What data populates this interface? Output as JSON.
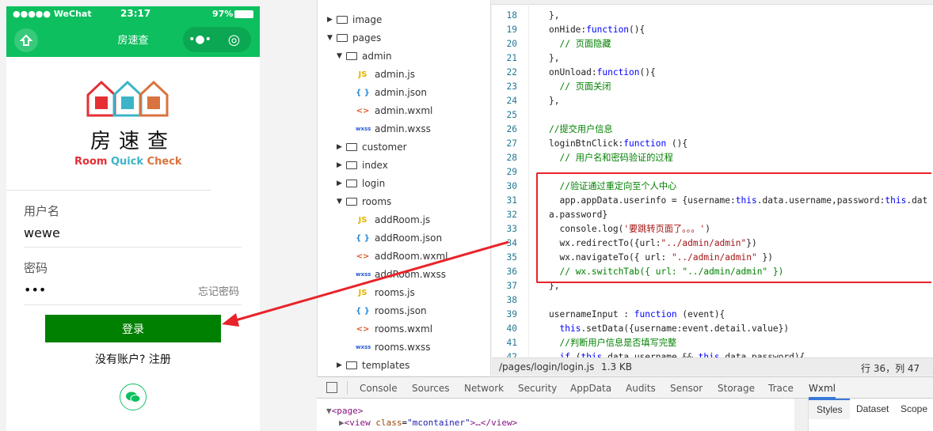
{
  "phone": {
    "status": {
      "carrier": "●●●●● WeChat",
      "time": "23:17",
      "battery": "97%"
    },
    "nav": {
      "title": "房速查",
      "more_icon": "•●•",
      "record_icon": "◎"
    },
    "logo": {
      "title": "房速查",
      "subtitle_words": [
        "Room",
        "Quick",
        "Check"
      ],
      "colors": [
        "#e52f35",
        "#3bb4c8",
        "#d9733f"
      ]
    },
    "form": {
      "username_label": "用户名",
      "username_value": "wewe",
      "password_label": "密码",
      "password_value": "•••",
      "forgot": "忘记密码",
      "login_button": "登录",
      "register": "没有账户? 注册"
    },
    "accent": "#0dbf5e"
  },
  "tree": [
    {
      "name": "image",
      "type": "folder",
      "level": 0,
      "open": false
    },
    {
      "name": "pages",
      "type": "folder",
      "level": 0,
      "open": true
    },
    {
      "name": "admin",
      "type": "folder",
      "level": 1,
      "open": true
    },
    {
      "name": "admin.js",
      "type": "js",
      "level": 2
    },
    {
      "name": "admin.json",
      "type": "json",
      "level": 2
    },
    {
      "name": "admin.wxml",
      "type": "wxml",
      "level": 2
    },
    {
      "name": "admin.wxss",
      "type": "wxss",
      "level": 2
    },
    {
      "name": "customer",
      "type": "folder",
      "level": 1,
      "open": false
    },
    {
      "name": "index",
      "type": "folder",
      "level": 1,
      "open": false
    },
    {
      "name": "login",
      "type": "folder",
      "level": 1,
      "open": false
    },
    {
      "name": "rooms",
      "type": "folder",
      "level": 1,
      "open": true
    },
    {
      "name": "addRoom.js",
      "type": "js",
      "level": 2
    },
    {
      "name": "addRoom.json",
      "type": "json",
      "level": 2
    },
    {
      "name": "addRoom.wxml",
      "type": "wxml",
      "level": 2
    },
    {
      "name": "addRoom.wxss",
      "type": "wxss",
      "level": 2
    },
    {
      "name": "rooms.js",
      "type": "js",
      "level": 2
    },
    {
      "name": "rooms.json",
      "type": "json",
      "level": 2
    },
    {
      "name": "rooms.wxml",
      "type": "wxml",
      "level": 2
    },
    {
      "name": "rooms.wxss",
      "type": "wxss",
      "level": 2
    },
    {
      "name": "templates",
      "type": "folder",
      "level": 1,
      "open": false
    }
  ],
  "code": [
    {
      "n": "18",
      "html": "},"
    },
    {
      "n": "19",
      "html": "onHide:<span class='kw'>function</span>(){"
    },
    {
      "n": "20",
      "html": "  <span class='cm'>// 页面隐藏</span>"
    },
    {
      "n": "21",
      "html": "},"
    },
    {
      "n": "22",
      "html": "onUnload:<span class='kw'>function</span>(){"
    },
    {
      "n": "23",
      "html": "  <span class='cm'>// 页面关闭</span>"
    },
    {
      "n": "24",
      "html": "},"
    },
    {
      "n": "25",
      "html": ""
    },
    {
      "n": "26",
      "html": "<span class='cm'>//提交用户信息</span>"
    },
    {
      "n": "27",
      "html": "loginBtnClick:<span class='kw'>function</span> (){"
    },
    {
      "n": "28",
      "html": "  <span class='cm'>// 用户名和密码验证的过程</span>"
    },
    {
      "n": "29",
      "html": ""
    },
    {
      "n": "30",
      "html": "  <span class='cm'>//验证通过重定向至个人中心</span>"
    },
    {
      "n": "31",
      "html": "  app.appData.userinfo = {username:<span class='kw'>this</span>.data.username,password:<span class='kw'>this</span>.data.password}"
    },
    {
      "n": "32",
      "html": ""
    },
    {
      "n": "33",
      "html": "  console.log(<span class='st'>'要跳转页面了。。。'</span>)"
    },
    {
      "n": "34",
      "html": "  wx.redirectTo({url:<span class='st'>\"../admin/admin\"</span>})"
    },
    {
      "n": "35",
      "html": "  wx.navigateTo({ url: <span class='st'>\"../admin/admin\"</span> })"
    },
    {
      "n": "36",
      "html": "  <span class='cm'>// wx.switchTab({ url: \"../admin/admin\" })</span>"
    },
    {
      "n": "37",
      "html": "},"
    },
    {
      "n": "38",
      "html": ""
    },
    {
      "n": "39",
      "html": "usernameInput : <span class='kw'>function</span> (event){"
    },
    {
      "n": "40",
      "html": "  <span class='kw'>this</span>.setData({username:event.detail.value})"
    },
    {
      "n": "41",
      "html": "  <span class='cm'>//判断用户信息是否填写完整</span>"
    },
    {
      "n": "42",
      "html": "  <span class='kw'>if</span> (<span class='kw'>this</span>.data.username && <span class='kw'>this</span>.data.password){"
    }
  ],
  "statusbar": {
    "path": "/pages/login/login.js",
    "size": "1.3 KB",
    "position": "行 36，列 47"
  },
  "devtools": {
    "tabs": [
      "Console",
      "Sources",
      "Network",
      "Security",
      "AppData",
      "Audits",
      "Sensor",
      "Storage",
      "Trace",
      "Wxml"
    ],
    "active": "Wxml",
    "side_tabs": [
      "Styles",
      "Dataset",
      "Scope"
    ]
  },
  "annotation_color": "#e8232a"
}
